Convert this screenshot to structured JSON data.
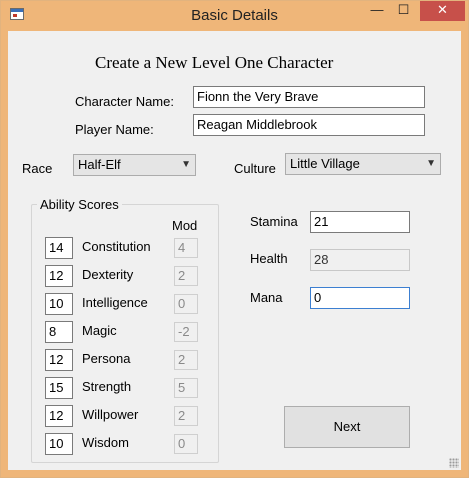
{
  "window": {
    "title": "Basic Details",
    "minimize_glyph": "—",
    "maximize_glyph": "☐",
    "close_glyph": "✕",
    "accent_color": "#efb679",
    "close_color": "#c7504a"
  },
  "form": {
    "heading": "Create a New Level One Character",
    "character_name_label": "Character Name:",
    "character_name_value": "Fionn the Very Brave",
    "player_name_label": "Player Name:",
    "player_name_value": "Reagan Middlebrook",
    "race_label": "Race",
    "race_value": "Half-Elf",
    "culture_label": "Culture",
    "culture_value": "Little Village"
  },
  "abilities": {
    "group_title": "Ability Scores",
    "mod_header": "Mod",
    "rows": [
      {
        "score": "14",
        "name": "Constitution",
        "mod": "4"
      },
      {
        "score": "12",
        "name": "Dexterity",
        "mod": "2"
      },
      {
        "score": "10",
        "name": "Intelligence",
        "mod": "0"
      },
      {
        "score": "8",
        "name": "Magic",
        "mod": "-2"
      },
      {
        "score": "12",
        "name": "Persona",
        "mod": "2"
      },
      {
        "score": "15",
        "name": "Strength",
        "mod": "5"
      },
      {
        "score": "12",
        "name": "Willpower",
        "mod": "2"
      },
      {
        "score": "10",
        "name": "Wisdom",
        "mod": "0"
      }
    ]
  },
  "stats": {
    "stamina_label": "Stamina",
    "stamina_value": "21",
    "health_label": "Health",
    "health_value": "28",
    "mana_label": "Mana",
    "mana_value": "0"
  },
  "actions": {
    "next_label": "Next"
  }
}
